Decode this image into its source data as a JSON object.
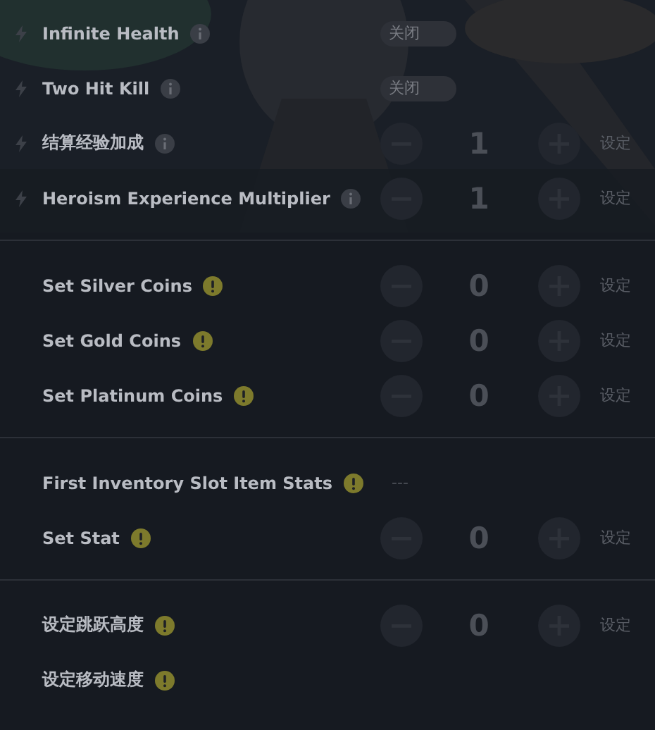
{
  "sections": [
    {
      "rows": [
        {
          "label": "Infinite Health",
          "bolt": true,
          "note": {
            "kind": "info"
          },
          "kind": "toggle",
          "toggle": {
            "text": "关闭",
            "on": false
          }
        },
        {
          "label": "Two Hit Kill",
          "bolt": true,
          "note": {
            "kind": "info"
          },
          "kind": "toggle",
          "toggle": {
            "text": "关闭",
            "on": false
          }
        },
        {
          "label": "结算经验加成",
          "bolt": true,
          "note": {
            "kind": "info"
          },
          "kind": "stepper",
          "value": "1",
          "apply": "设定"
        },
        {
          "label": "Heroism Experience Multiplier",
          "bolt": true,
          "note": {
            "kind": "info"
          },
          "kind": "stepper",
          "value": "1",
          "apply": "设定"
        }
      ]
    },
    {
      "rows": [
        {
          "label": "Set Silver Coins",
          "bolt": false,
          "note": {
            "kind": "warning"
          },
          "kind": "stepper",
          "value": "0",
          "apply": "设定"
        },
        {
          "label": "Set Gold Coins",
          "bolt": false,
          "note": {
            "kind": "warning"
          },
          "kind": "stepper",
          "value": "0",
          "apply": "设定"
        },
        {
          "label": "Set Platinum Coins",
          "bolt": false,
          "note": {
            "kind": "warning"
          },
          "kind": "stepper",
          "value": "0",
          "apply": "设定"
        }
      ]
    },
    {
      "rows": [
        {
          "label": "First Inventory Slot Item Stats",
          "bolt": false,
          "note": {
            "kind": "warning"
          },
          "kind": "display",
          "value": "---"
        },
        {
          "label": "Set Stat",
          "bolt": false,
          "note": {
            "kind": "warning"
          },
          "kind": "stepper",
          "value": "0",
          "apply": "设定"
        }
      ]
    },
    {
      "rows": [
        {
          "label": "设定跳跃高度",
          "bolt": false,
          "note": {
            "kind": "warning"
          },
          "kind": "stepper",
          "value": "0",
          "apply": "设定"
        },
        {
          "label": "设定移动速度",
          "bolt": false,
          "note": {
            "kind": "warning"
          },
          "kind": "none"
        }
      ]
    }
  ]
}
